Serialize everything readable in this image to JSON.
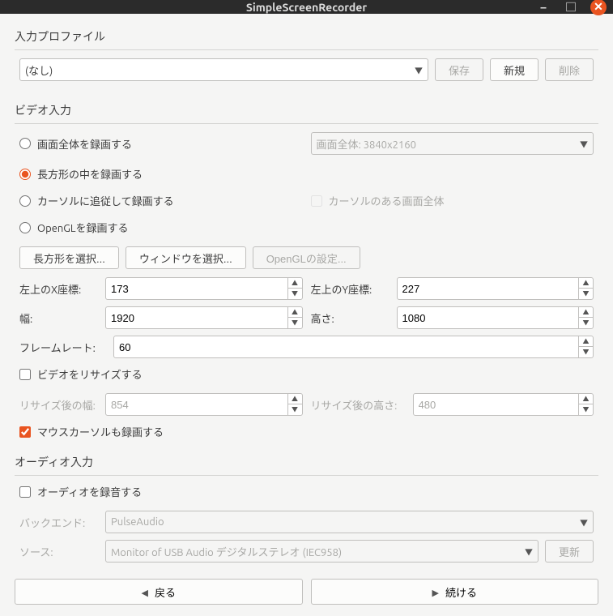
{
  "titlebar": {
    "title": "SimpleScreenRecorder"
  },
  "profile": {
    "section_title": "入力プロファイル",
    "selected": "(なし)",
    "save_label": "保存",
    "new_label": "新規",
    "delete_label": "削除"
  },
  "video": {
    "section_title": "ビデオ入力",
    "radio_fullscreen": "画面全体を録画する",
    "radio_rect": "長方形の中を録画する",
    "radio_cursor": "カーソルに追従して録画する",
    "radio_opengl": "OpenGLを録画する",
    "screen_selected": "画面全体: 3840x2160",
    "chk_cursor_screen": "カーソルのある画面全体",
    "btn_select_rect": "長方形を選択...",
    "btn_select_window": "ウィンドウを選択...",
    "btn_opengl_settings": "OpenGLの設定...",
    "label_x": "左上のX座標:",
    "label_y": "左上のY座標:",
    "label_w": "幅:",
    "label_h": "高さ:",
    "label_fps": "フレームレート:",
    "val_x": "173",
    "val_y": "227",
    "val_w": "1920",
    "val_h": "1080",
    "val_fps": "60",
    "chk_resize": "ビデオをリサイズする",
    "label_rw": "リサイズ後の幅:",
    "label_rh": "リサイズ後の高さ:",
    "val_rw": "854",
    "val_rh": "480",
    "chk_record_cursor": "マウスカーソルも録画する"
  },
  "audio": {
    "section_title": "オーディオ入力",
    "chk_record_audio": "オーディオを録音する",
    "label_backend": "バックエンド:",
    "val_backend": "PulseAudio",
    "label_source": "ソース:",
    "val_source": "Monitor of USB Audio デジタルステレオ (IEC958)",
    "btn_refresh": "更新"
  },
  "footer": {
    "back": "戻る",
    "next": "続ける"
  }
}
